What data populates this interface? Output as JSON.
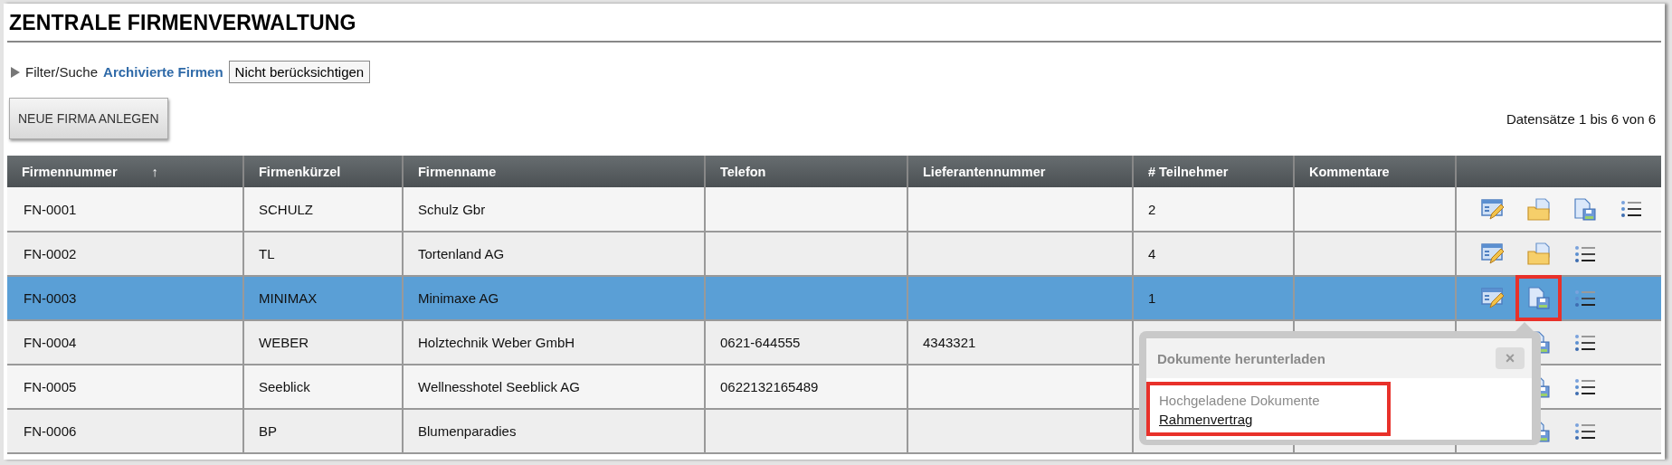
{
  "title": "ZENTRALE FIRMENVERWALTUNG",
  "filter": {
    "label": "Filter/Suche",
    "archived_label": "Archivierte Firmen",
    "archived_value": "Nicht berücksichtigen"
  },
  "new_button": "NEUE FIRMA ANLEGEN",
  "record_count": "Datensätze 1 bis 6 von 6",
  "table": {
    "columns": [
      {
        "kind": "text",
        "label": "Firmennummer",
        "sort": "↑"
      },
      {
        "kind": "text",
        "label": "Firmenkürzel"
      },
      {
        "kind": "text",
        "label": "Firmenname"
      },
      {
        "kind": "text",
        "label": "Telefon"
      },
      {
        "kind": "text",
        "label": "Lieferantennummer"
      },
      {
        "kind": "text",
        "label": "# Teilnehmer"
      },
      {
        "kind": "text",
        "label": "Kommentare"
      },
      {
        "kind": "actions"
      }
    ],
    "rows": [
      {
        "selected": false,
        "cells": [
          "FN-0001",
          "SCHULZ",
          "Schulz Gbr",
          null,
          null,
          "2",
          null
        ],
        "actions": [
          {
            "kind": "edit",
            "highlighted": false
          },
          {
            "kind": "folder",
            "highlighted": false
          },
          {
            "kind": "save",
            "highlighted": false
          },
          {
            "kind": "list",
            "highlighted": false
          }
        ]
      },
      {
        "selected": false,
        "cells": [
          "FN-0002",
          "TL",
          "Tortenland AG",
          null,
          null,
          "4",
          null
        ],
        "actions": [
          {
            "kind": "edit",
            "highlighted": false
          },
          {
            "kind": "folder",
            "highlighted": false
          },
          {
            "kind": "list",
            "highlighted": false
          }
        ]
      },
      {
        "selected": true,
        "cells": [
          "FN-0003",
          "MINIMAX",
          "Minimaxe AG",
          null,
          null,
          "1",
          null
        ],
        "actions": [
          {
            "kind": "edit",
            "highlighted": false
          },
          {
            "kind": "save",
            "highlighted": true
          },
          {
            "kind": "list",
            "highlighted": false
          }
        ]
      },
      {
        "selected": false,
        "cells": [
          "FN-0004",
          "WEBER",
          "Holztechnik Weber GmbH",
          "0621-644555",
          "4343321",
          null,
          null
        ],
        "actions": [
          {
            "kind": "covered"
          },
          {
            "kind": "save",
            "highlighted": false
          },
          {
            "kind": "list",
            "highlighted": false
          }
        ]
      },
      {
        "selected": false,
        "cells": [
          "FN-0005",
          "Seeblick",
          "Wellnesshotel Seeblick AG",
          "0622132165489",
          null,
          null,
          null
        ],
        "actions": [
          {
            "kind": "covered"
          },
          {
            "kind": "save",
            "highlighted": false
          },
          {
            "kind": "list",
            "highlighted": false
          }
        ]
      },
      {
        "selected": false,
        "cells": [
          "FN-0006",
          "BP",
          "Blumenparadies",
          null,
          null,
          null,
          null
        ],
        "actions": [
          {
            "kind": "covered"
          },
          {
            "kind": "save",
            "highlighted": false
          },
          {
            "kind": "list",
            "highlighted": false
          }
        ]
      }
    ]
  },
  "popup": {
    "title": "Dokumente herunterladen",
    "close": "×",
    "section": "Hochgeladene Dokumente",
    "documents": [
      "Rahmenvertrag"
    ],
    "highlighted": true
  }
}
